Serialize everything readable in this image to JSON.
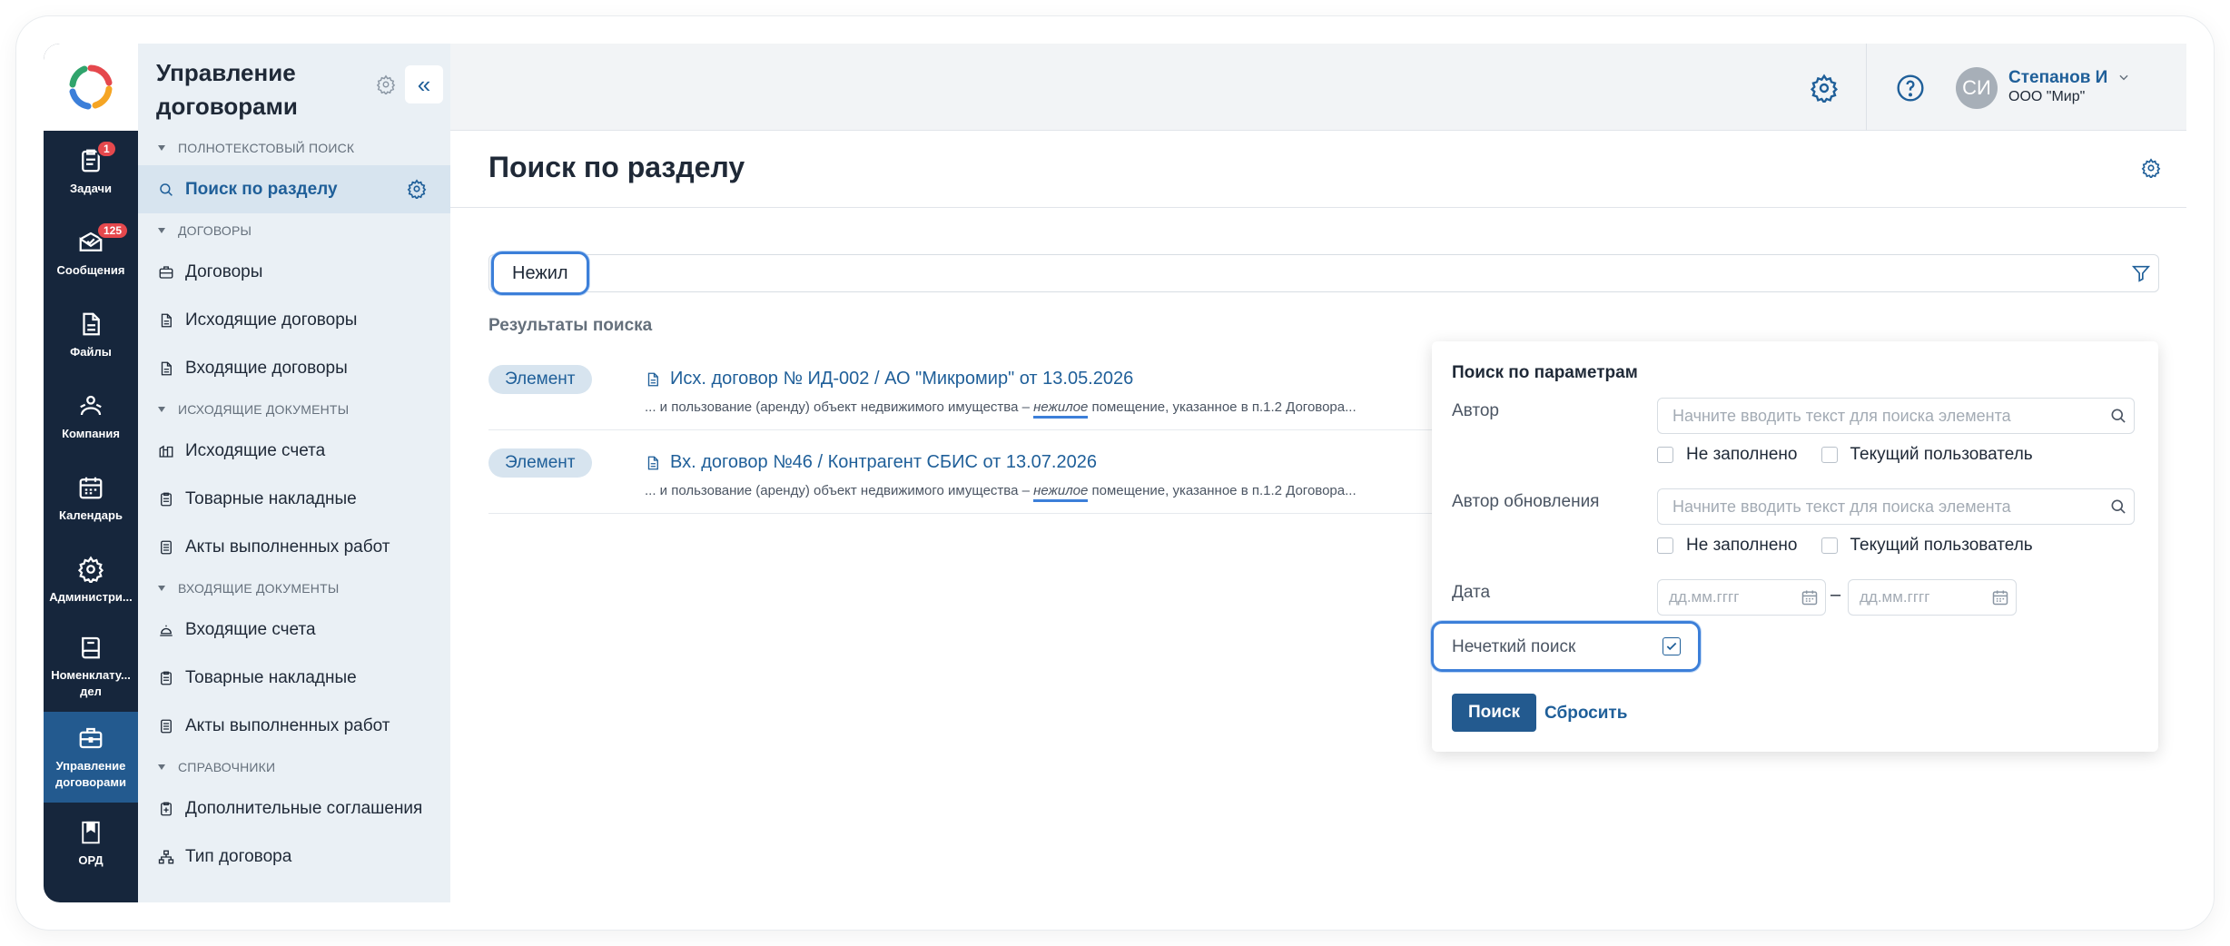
{
  "rail": {
    "items": [
      {
        "label": "Задачи",
        "icon": "tasks-icon",
        "badge": "1"
      },
      {
        "label": "Сообщения",
        "icon": "messages-icon",
        "badge": "125"
      },
      {
        "label": "Файлы",
        "icon": "file-icon",
        "badge": ""
      },
      {
        "label": "Компания",
        "icon": "company-icon",
        "badge": ""
      },
      {
        "label": "Календарь",
        "icon": "calendar-icon",
        "badge": ""
      },
      {
        "label": "Администри...",
        "icon": "gear-icon",
        "badge": ""
      },
      {
        "label": "Номенклату...\nдел",
        "icon": "book-icon",
        "badge": ""
      },
      {
        "label": "Управление\nдоговорами",
        "icon": "briefcase-icon",
        "badge": "",
        "active": true
      },
      {
        "label": "ОРД",
        "icon": "bookmark-icon",
        "badge": ""
      }
    ]
  },
  "sidebar": {
    "title": "Управление договорами",
    "collapse_glyph": "«",
    "groups": [
      {
        "label": "Полнотекстовый поиск",
        "items": [
          "Поиск по разделу"
        ]
      },
      {
        "label": "Договоры",
        "items": [
          "Договоры",
          "Исходящие договоры",
          "Входящие договоры"
        ]
      },
      {
        "label": "Исходящие документы",
        "items": [
          "Исходящие счета",
          "Товарные накладные",
          "Акты выполненных работ"
        ]
      },
      {
        "label": "Входящие документы",
        "items": [
          "Входящие счета",
          "Товарные накладные",
          "Акты выполненных работ"
        ]
      },
      {
        "label": "Справочники",
        "items": [
          "Дополнительные соглашения",
          "Тип договора"
        ]
      }
    ]
  },
  "topbar": {
    "avatar_initials": "СИ",
    "user_name": "Степанов И",
    "user_org": "ООО \"Мир\""
  },
  "page": {
    "title": "Поиск по разделу",
    "search_value": "Нежил",
    "results_label": "Результаты поиска"
  },
  "results": [
    {
      "chip": "Элемент",
      "title": "Исх. договор № ИД-002 / АО \"Микромир\" от 13.05.2026",
      "snippet_before": "... и пользование (аренду) объект недвижимого имущества – ",
      "snippet_hl": "нежилое",
      "snippet_after": " помещение, указанное в п.1.2 Договора..."
    },
    {
      "chip": "Элемент",
      "title": "Вх. договор №46 / Контрагент СБИС от 13.07.2026",
      "snippet_before": "... и пользование (аренду) объект недвижимого имущества – ",
      "snippet_hl": "нежилое",
      "snippet_after": " помещение, указанное в п.1.2 Договора..."
    }
  ],
  "filter_panel": {
    "title": "Поиск по параметрам",
    "author_label": "Автор",
    "author_placeholder": "Начните вводить текст для поиска элемента",
    "updater_label": "Автор обновления",
    "updater_placeholder": "Начните вводить текст для поиска элемента",
    "not_filled": "Не заполнено",
    "current_user": "Текущий пользователь",
    "date_label": "Дата",
    "date_from_placeholder": "дд.мм.гггг",
    "date_to_placeholder": "дд.мм.гггг",
    "date_separator": "–",
    "fuzzy_label": "Нечеткий поиск",
    "fuzzy_checked": true,
    "search_button": "Поиск",
    "reset_button": "Сбросить"
  },
  "colors": {
    "rail_bg": "#16263c",
    "rail_active": "#235a8f",
    "accent": "#1f5f99",
    "highlight": "#3c7fd9",
    "badge": "#e5484d"
  }
}
